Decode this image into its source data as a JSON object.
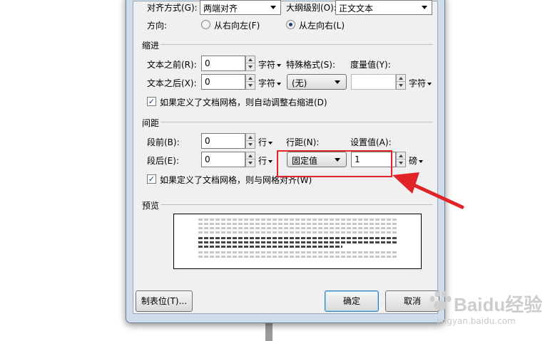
{
  "paragraph": {
    "alignment": {
      "label": "对齐方式(G):",
      "value": "两端对齐"
    },
    "outline_level": {
      "label": "大纲级别(O):",
      "value": "正文文本"
    },
    "direction": {
      "label": "方向:",
      "rtl": "从右向左(F)",
      "ltr": "从左向右(L)"
    }
  },
  "indent": {
    "title": "缩进",
    "before": {
      "label": "文本之前(R):",
      "value": "0",
      "unit": "字符"
    },
    "after": {
      "label": "文本之后(X):",
      "value": "0",
      "unit": "字符"
    },
    "special": {
      "label": "特殊格式(S):",
      "value": "(无)"
    },
    "measure": {
      "label": "度量值(Y):",
      "value": "",
      "unit": "字符"
    },
    "auto_adjust": "如果定义了文档网格，则自动调整右缩进(D)"
  },
  "spacing": {
    "title": "间距",
    "before": {
      "label": "段前(B):",
      "value": "0",
      "unit": "行"
    },
    "after": {
      "label": "段后(E):",
      "value": "0",
      "unit": "行"
    },
    "line_spacing": {
      "label": "行距(N):",
      "value": "固定值"
    },
    "set_value": {
      "label": "设置值(A):",
      "value": "1",
      "unit": "磅"
    },
    "snap_grid": "如果定义了文档网格，则与网格对齐(W)"
  },
  "preview": {
    "title": "预览"
  },
  "buttons": {
    "tabs": "制表位(T)...",
    "ok": "确定",
    "cancel": "取消"
  },
  "watermark": {
    "brand": "Baidu经验",
    "url": "jingyan.baidu.com"
  },
  "colors": {
    "highlight": "#e0242a",
    "arrow": "#e0242a"
  },
  "icons": {
    "checkbox_checked": "check-icon",
    "pointer": "red-arrow-icon"
  }
}
